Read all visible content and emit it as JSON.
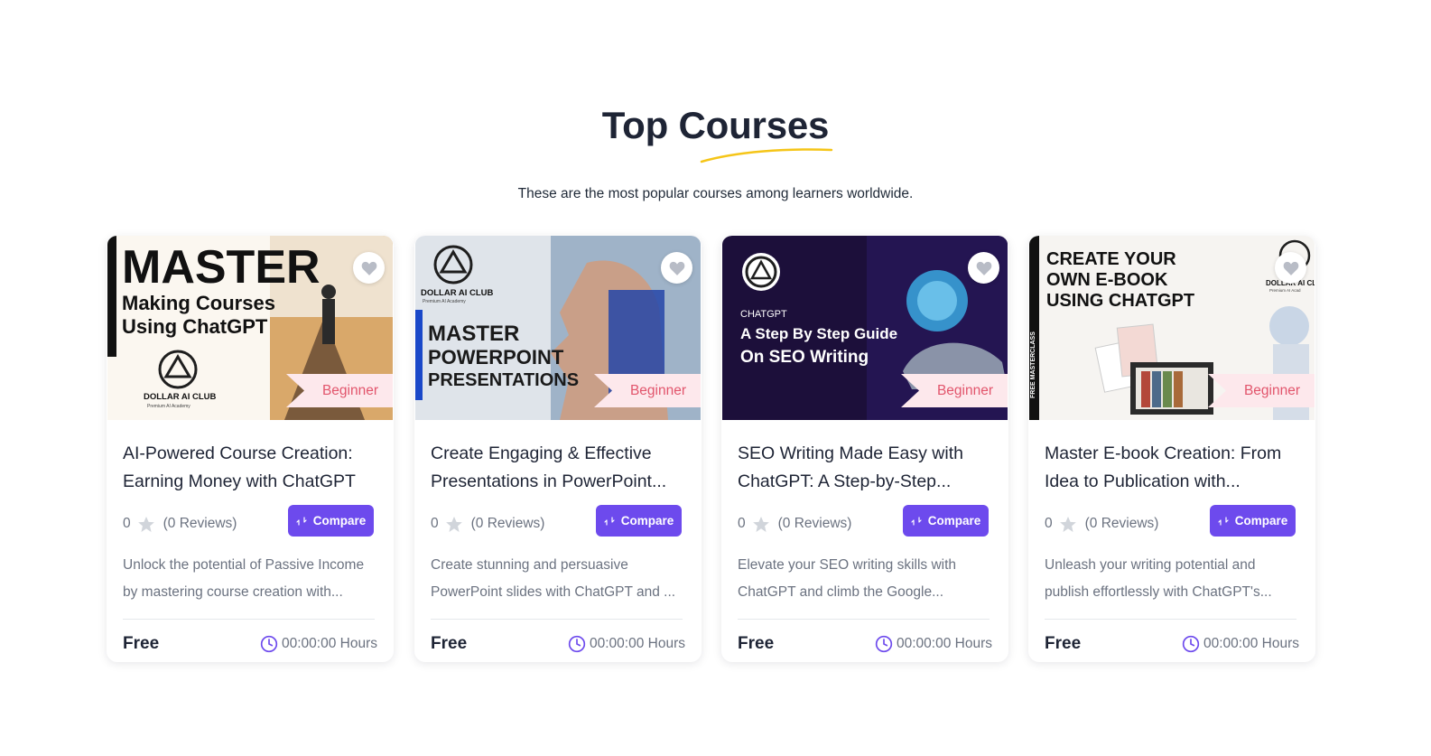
{
  "section": {
    "title": "Top Courses",
    "subtitle": "These are the most popular courses among learners worldwide."
  },
  "colors": {
    "accent": "#6d4aed",
    "badge_bg": "#fde8ec",
    "badge_text": "#e2556c",
    "underline": "#f5c518"
  },
  "icons": {
    "wishlist": "heart-icon",
    "rating": "star-icon",
    "compare": "compare-icon",
    "duration": "clock-icon"
  },
  "cards": [
    {
      "thumb": {
        "line1": "MASTER",
        "line2": "Making Courses",
        "line3": "Using ChatGPT",
        "brand": "DOLLAR AI CLUB",
        "brand_sub": "Premium AI Academy"
      },
      "level": "Beginner",
      "title": "AI-Powered Course Creation: Earning Money with ChatGPT",
      "rating": "0",
      "reviews": "(0 Reviews)",
      "compare": "Compare",
      "desc1": "Unlock the potential of Passive Income",
      "desc2": "by mastering course creation with...",
      "price": "Free",
      "duration": "00:00:00 Hours"
    },
    {
      "thumb": {
        "line1": "MASTER",
        "line2": "POWERPOINT",
        "line3": "PRESENTATIONS",
        "brand": "DOLLAR AI CLUB",
        "brand_sub": "Premium AI Academy"
      },
      "level": "Beginner",
      "title": "Create Engaging & Effective Presentations in PowerPoint...",
      "rating": "0",
      "reviews": "(0 Reviews)",
      "compare": "Compare",
      "desc1": "Create stunning and persuasive",
      "desc2": "PowerPoint slides with ChatGPT and ...",
      "price": "Free",
      "duration": "00:00:00 Hours"
    },
    {
      "thumb": {
        "line1": "CHATGPT",
        "line2": "A Step By Step Guide",
        "line3": "On SEO Writing"
      },
      "level": "Beginner",
      "title": "SEO Writing Made Easy with ChatGPT: A Step-by-Step...",
      "rating": "0",
      "reviews": "(0 Reviews)",
      "compare": "Compare",
      "desc1": "Elevate your SEO writing skills with",
      "desc2": "ChatGPT and climb the Google...",
      "price": "Free",
      "duration": "00:00:00 Hours"
    },
    {
      "thumb": {
        "line1": "CREATE YOUR",
        "line2": "OWN E-BOOK",
        "line3": "USING CHATGPT",
        "side": "FREE MASTERCLASS",
        "brand": "DOLLAR AI CL",
        "brand_sub": "Premium AI Acad"
      },
      "level": "Beginner",
      "title": "Master E-book Creation: From Idea to Publication with...",
      "rating": "0",
      "reviews": "(0 Reviews)",
      "compare": "Compare",
      "desc1": "Unleash your writing potential and",
      "desc2": "publish effortlessly with ChatGPT's...",
      "price": "Free",
      "duration": "00:00:00 Hours"
    }
  ]
}
